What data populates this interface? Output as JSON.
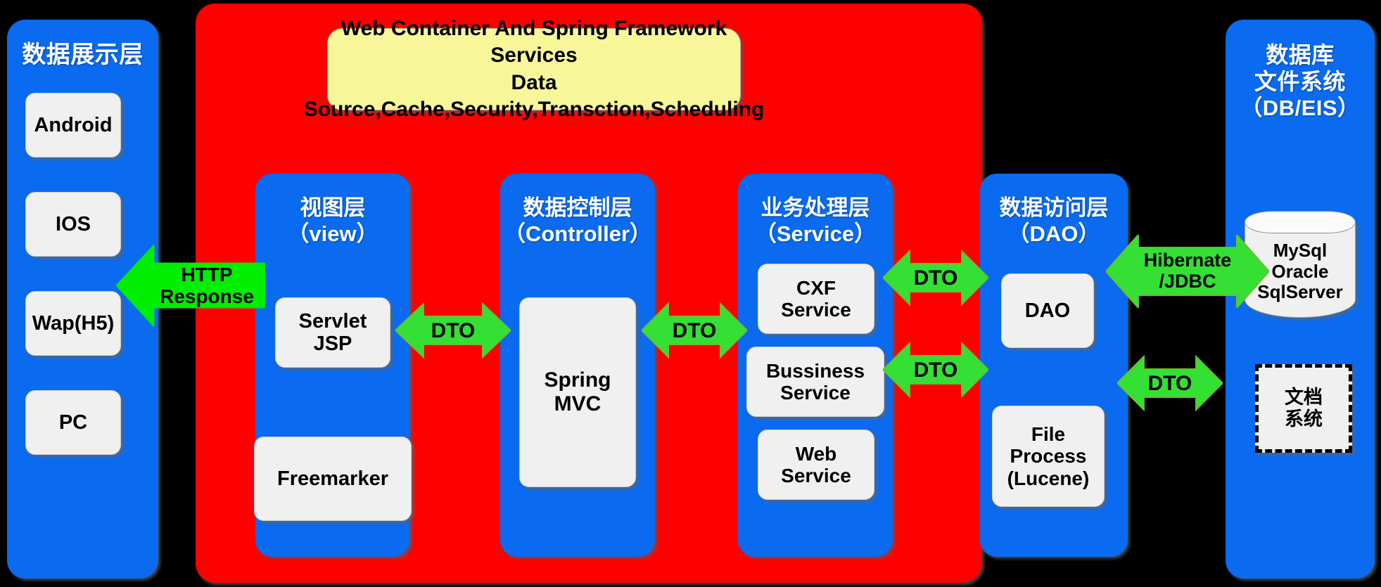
{
  "left_panel": {
    "title": "数据展示层",
    "clients": [
      {
        "label": "Android"
      },
      {
        "label": "IOS"
      },
      {
        "label": "Wap(H5)"
      },
      {
        "label": "PC"
      }
    ]
  },
  "center": {
    "banner": {
      "line1": "Web Container And Spring Framework Services",
      "line2": "Data Source,Cache,Security,Transction,Scheduling"
    },
    "columns": [
      {
        "title_cn": "视图层",
        "title_en": "（view）",
        "items": [
          {
            "label": "Servlet\nJSP"
          },
          {
            "label": "Freemarker"
          }
        ]
      },
      {
        "title_cn": "数据控制层",
        "title_en": "（Controller）",
        "items": [
          {
            "label": "Spring\nMVC"
          }
        ]
      },
      {
        "title_cn": "业务处理层",
        "title_en": "（Service）",
        "items": [
          {
            "label": "CXF\nService"
          },
          {
            "label": "Bussiness\nService"
          },
          {
            "label": "Web\nService"
          }
        ]
      },
      {
        "title_cn": "数据访问层",
        "title_en": "（DAO）",
        "items": [
          {
            "label": "DAO"
          },
          {
            "label": "File\nProcess\n(Lucene)"
          }
        ]
      }
    ]
  },
  "right_panel": {
    "title_line1": "数据库",
    "title_line2": "文件系统",
    "title_line3": "（DB/EIS）",
    "database": {
      "line1": "MySql",
      "line2": "Oracle",
      "line3": "SqlServer"
    },
    "document_store": {
      "line1": "文档",
      "line2": "系统"
    }
  },
  "arrows": {
    "http_response": {
      "line1": "HTTP",
      "line2": "Response",
      "direction": "left"
    },
    "view_controller": {
      "label": "DTO",
      "direction": "both"
    },
    "controller_service": {
      "label": "DTO",
      "direction": "both"
    },
    "service_dao": {
      "label": "DTO",
      "direction": "both"
    },
    "service_file": {
      "label": "DTO",
      "direction": "both"
    },
    "hibernate_jdbc": {
      "line1": "Hibernate",
      "line2": "/JDBC",
      "direction": "both"
    },
    "file_document": {
      "label": "DTO",
      "direction": "both"
    }
  },
  "colors": {
    "background": "#000000",
    "panel_blue": "#0a6bf0",
    "container_red": "#ff0000",
    "banner_yellow": "#f7f79a",
    "arrow_green": "#00ee00",
    "box_white": "#f0f0f0"
  }
}
